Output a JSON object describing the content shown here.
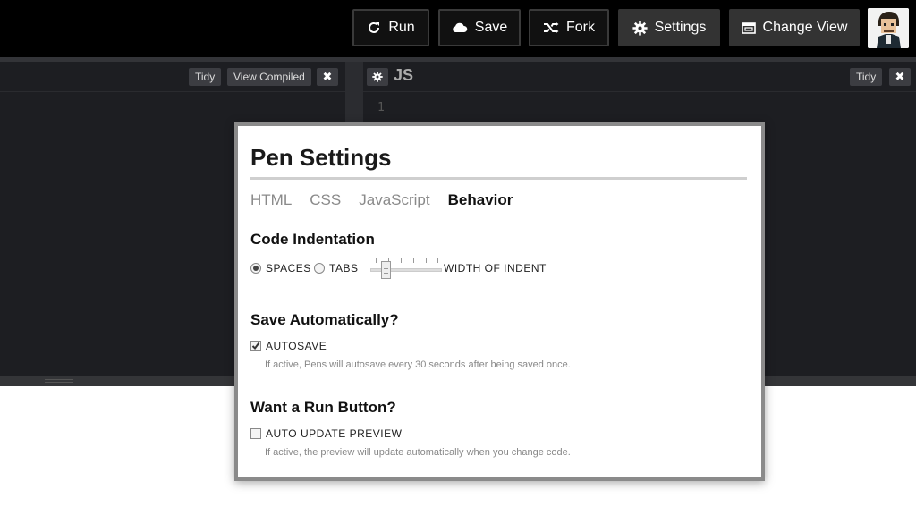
{
  "header": {
    "buttons": {
      "run": "Run",
      "save": "Save",
      "fork": "Fork",
      "settings": "Settings",
      "change_view": "Change View"
    }
  },
  "editors": {
    "left_pane": {
      "tidy": "Tidy",
      "view_compiled": "View Compiled",
      "close": "✖"
    },
    "right_pane": {
      "title": "JS",
      "tidy": "Tidy",
      "close": "✖",
      "line_number": "1"
    }
  },
  "modal": {
    "title": "Pen Settings",
    "tabs": [
      "HTML",
      "CSS",
      "JavaScript",
      "Behavior"
    ],
    "active_tab": "Behavior",
    "indentation": {
      "title": "Code Indentation",
      "spaces_label": "SPACES",
      "tabs_label": "TABS",
      "selected": "SPACES",
      "width_label": "WIDTH OF INDENT",
      "width_value_fraction": 0.2
    },
    "autosave": {
      "title": "Save Automatically?",
      "label": "AUTOSAVE",
      "checked": true,
      "hint": "If active, Pens will autosave every 30 seconds after being saved once."
    },
    "run_button": {
      "title": "Want a Run Button?",
      "label": "AUTO UPDATE PREVIEW",
      "checked": false,
      "hint": "If active, the preview will update automatically when you change code."
    }
  },
  "colors": {
    "header_bg": "#000000",
    "editor_bg": "#1d1e22",
    "modal_border": "#8a8a8a"
  }
}
